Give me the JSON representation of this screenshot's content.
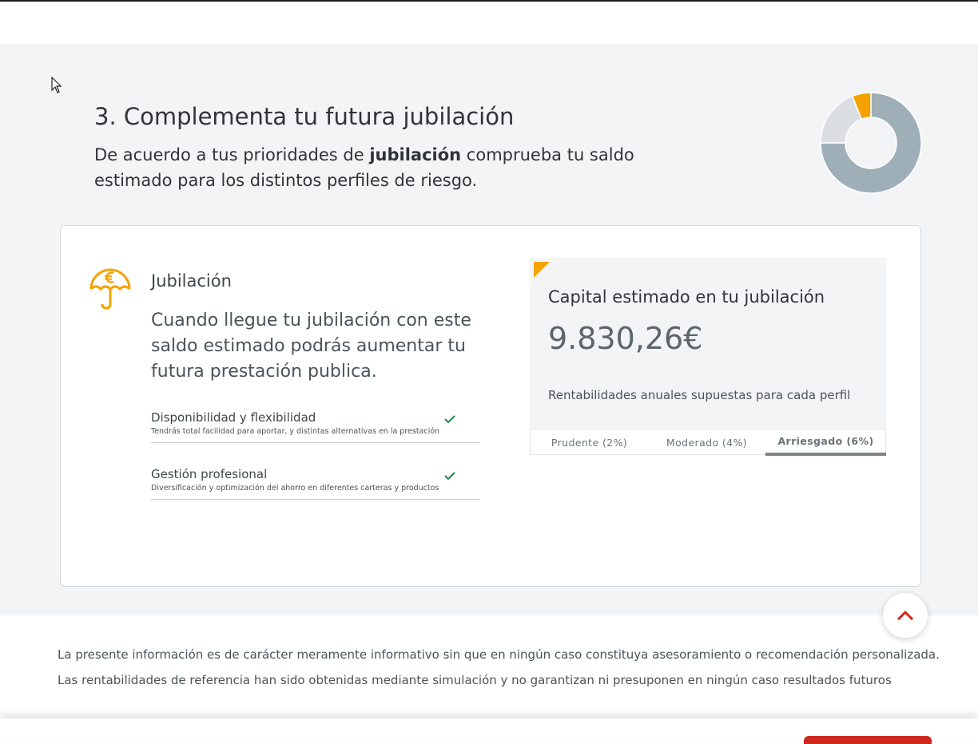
{
  "section": {
    "title": "3. Complementa tu futura jubilación",
    "subtitle_before": "De acuerdo a tus prioridades de ",
    "subtitle_bold": "jubilación",
    "subtitle_after": " comprueba tu saldo estimado para los distintos perfiles de riesgo."
  },
  "donut_chart": {
    "slices": [
      {
        "share": 0.75,
        "color": "#9eafb8"
      },
      {
        "share": 0.19,
        "color": "#dadee2"
      },
      {
        "share": 0.06,
        "color": "#f5a200"
      }
    ]
  },
  "profile": {
    "icon": "umbrella-euro-icon",
    "name": "Jubilación",
    "description": "Cuando llegue tu jubilación con este saldo estimado podrás aumentar tu futura prestación publica.",
    "features": [
      {
        "title": "Disponibilidad y flexibilidad",
        "subtitle": "Tendrás total facilidad para aportar, y distintas alternativas en la prestación"
      },
      {
        "title": "Gestión profesional",
        "subtitle": "Diversificación y optimización del ahorro en diferentes carteras y productos"
      }
    ]
  },
  "result": {
    "label": "Capital estimado en tu jubilación",
    "value": "9.830,26€",
    "note": "Rentabilidades anuales supuestas para cada perfil",
    "tabs": [
      "Prudente (2%)",
      "Moderado (4%)",
      "Arriesgado (6%)"
    ],
    "active_tab": "Arriesgado (6%)"
  },
  "disclaimer": [
    "La presente información es de carácter meramente informativo sin que en ningún caso constituya asesoramiento o recomendación personalizada.",
    "Las rentabilidades de referencia han sido obtenidas mediante simulación y no garantizan ni presuponen en ningún caso resultados futuros"
  ],
  "colors": {
    "accent": "#f5a200",
    "check": "#1a8a4a",
    "cta": "#d0271c",
    "background_band": "#f3f4f5"
  }
}
